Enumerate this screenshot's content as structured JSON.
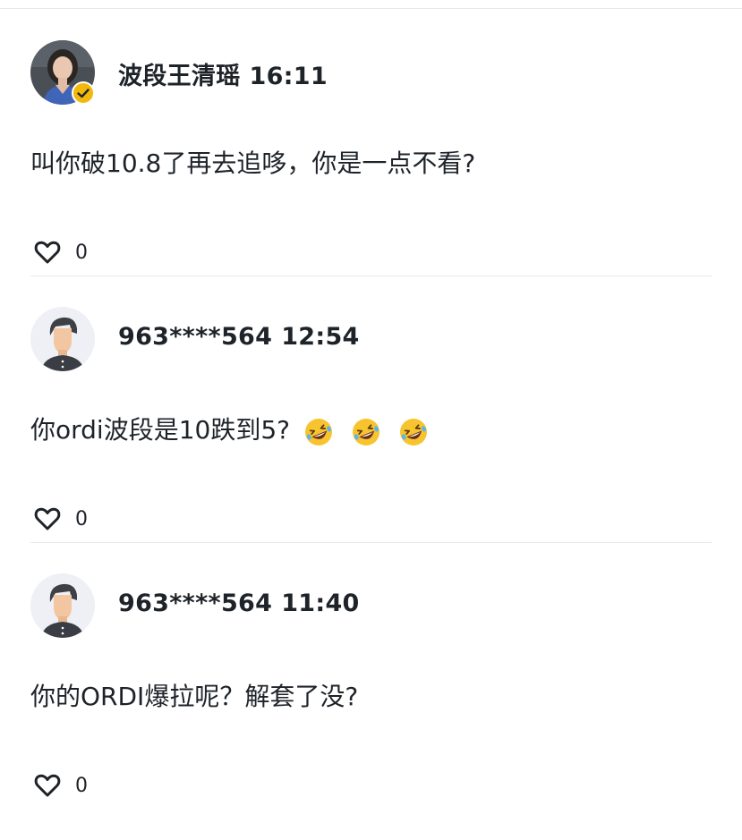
{
  "comments": [
    {
      "author": "波段王清瑶",
      "time": "16:11",
      "text": "叫你破10.8了再去追哆，你是一点不看?",
      "likes": "0",
      "verified": true,
      "avatar": "profile-photo",
      "emojis": []
    },
    {
      "author": "963****564",
      "time": "12:54",
      "text": "你ordi波段是10跌到5?",
      "likes": "0",
      "verified": false,
      "avatar": "default-user-avatar",
      "emojis": [
        "rofl-emoji",
        "rofl-emoji",
        "rofl-emoji"
      ]
    },
    {
      "author": "963****564",
      "time": "11:40",
      "text": "你的ORDI爆拉呢？解套了没?",
      "likes": "0",
      "verified": false,
      "avatar": "default-user-avatar",
      "emojis": []
    }
  ],
  "icons": {
    "like": "heart-outline-icon",
    "verified": "verified-badge-icon"
  },
  "colors": {
    "text": "#1e2329",
    "divider": "#e6e8ea",
    "verified_badge": "#f0b90b"
  }
}
